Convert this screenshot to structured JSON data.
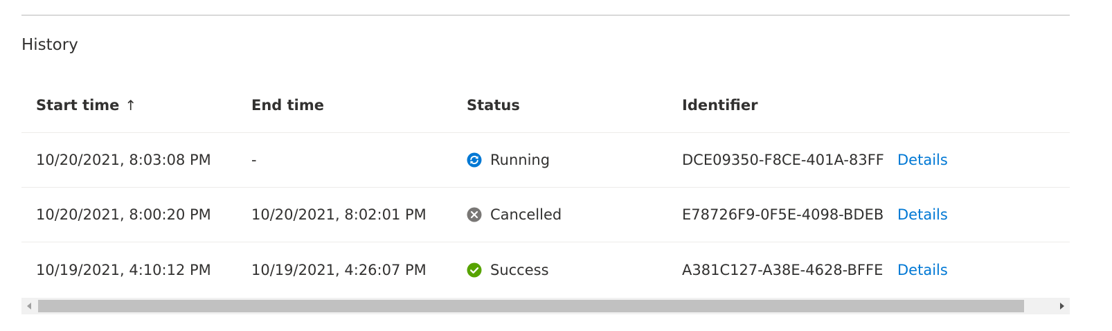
{
  "section": {
    "title": "History"
  },
  "table": {
    "columns": [
      {
        "label": "Start time",
        "sort_indicator": "↑"
      },
      {
        "label": "End time"
      },
      {
        "label": "Status"
      },
      {
        "label": "Identifier"
      }
    ],
    "rows": [
      {
        "start_time": "10/20/2021, 8:03:08 PM",
        "end_time": "-",
        "status": "Running",
        "status_icon": "running-icon",
        "status_color": "#0078d4",
        "identifier": "DCE09350-F8CE-401A-83FF",
        "action": "Details"
      },
      {
        "start_time": "10/20/2021, 8:00:20 PM",
        "end_time": "10/20/2021, 8:02:01 PM",
        "status": "Cancelled",
        "status_icon": "cancelled-icon",
        "status_color": "#797775",
        "identifier": "E78726F9-0F5E-4098-BDEB-",
        "action": "Details"
      },
      {
        "start_time": "10/19/2021, 4:10:12 PM",
        "end_time": "10/19/2021, 4:26:07 PM",
        "status": "Success",
        "status_icon": "success-icon",
        "status_color": "#57a300",
        "identifier": "A381C127-A38E-4628-BFFE",
        "action": "Details"
      }
    ]
  },
  "colors": {
    "link": "#0078d4",
    "divider": "#edebe9",
    "text": "#323130"
  }
}
